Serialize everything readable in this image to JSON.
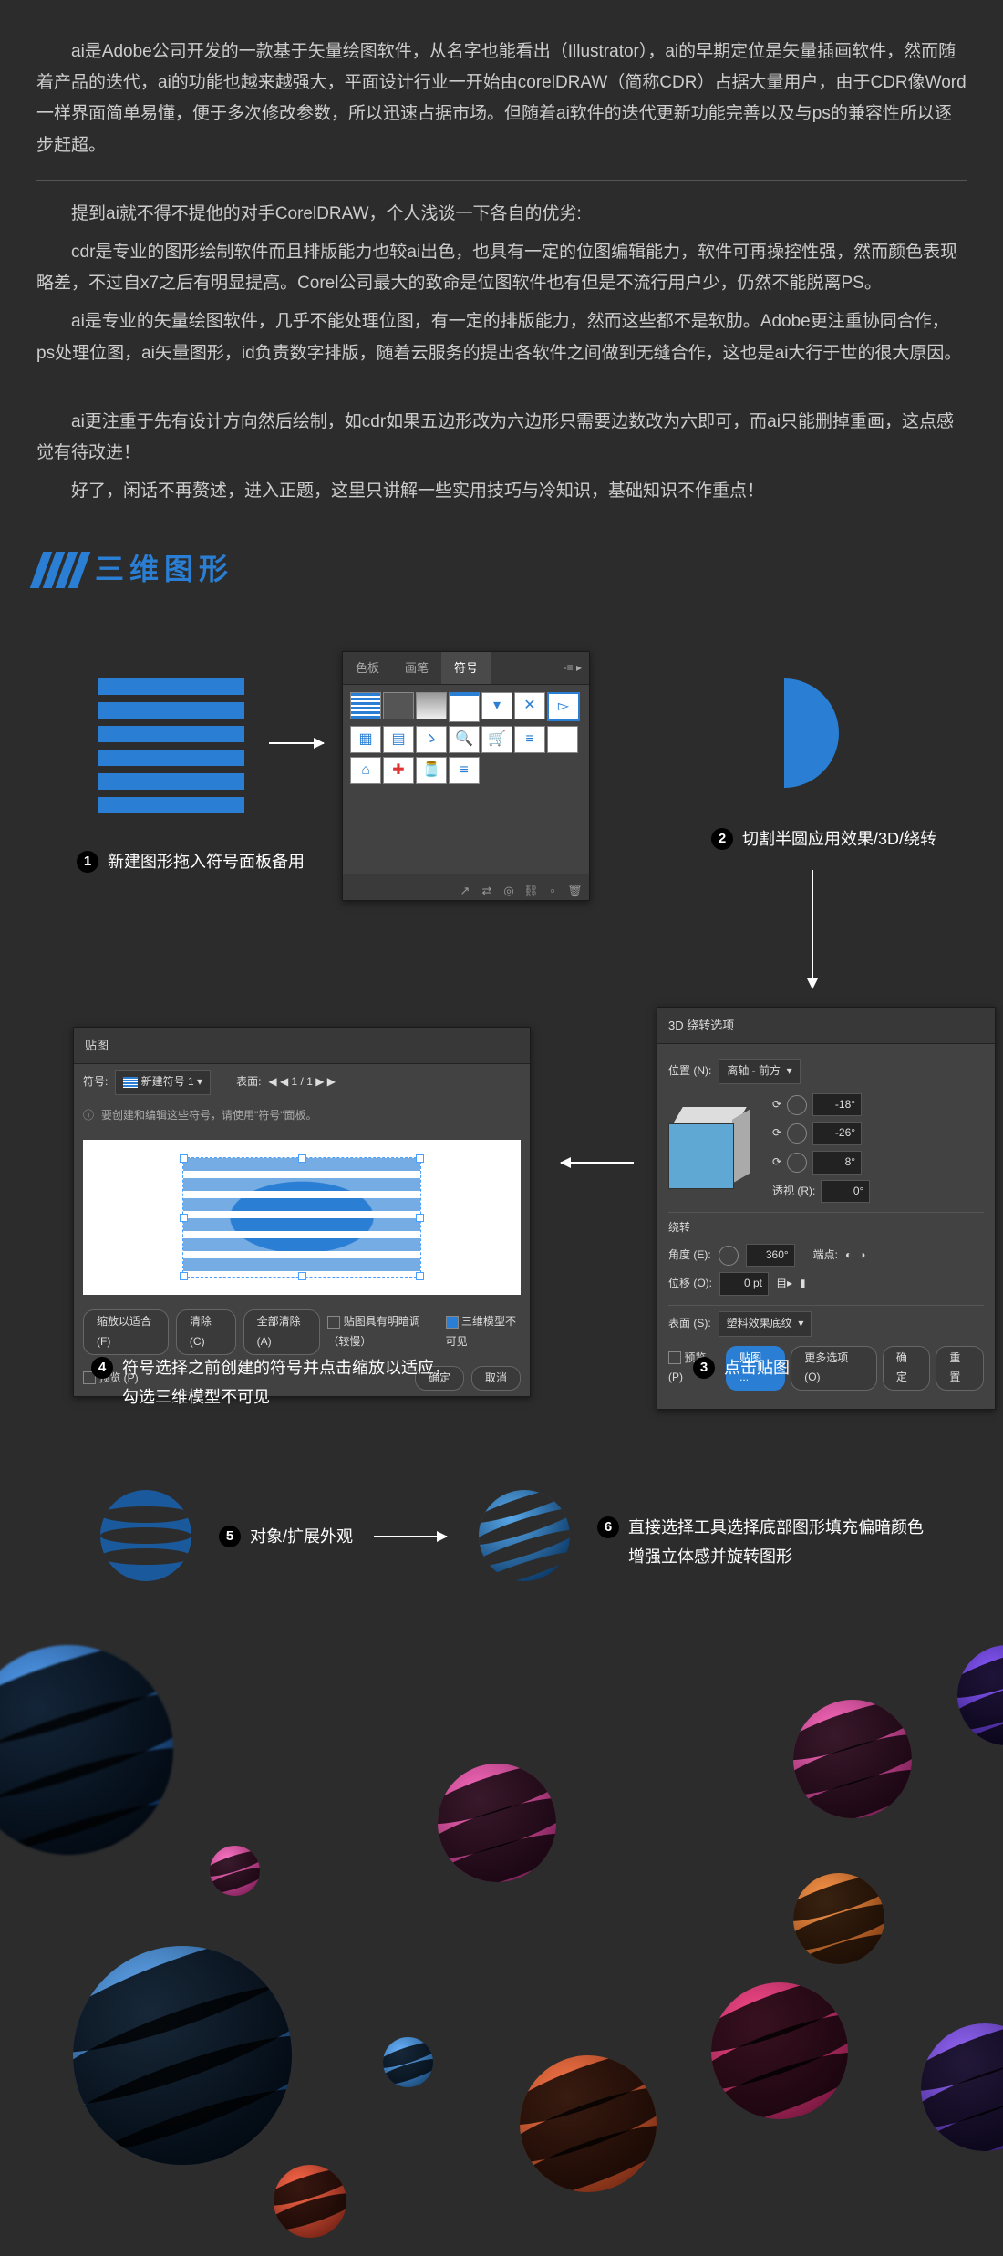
{
  "intro": {
    "p1": "ai是Adobe公司开发的一款基于矢量绘图软件，从名字也能看出（Illustrator），ai的早期定位是矢量插画软件，然而随着产品的迭代，ai的功能也越来越强大，平面设计行业一开始由corelDRAW（简称CDR）占据大量用户，由于CDR像Word一样界面简单易懂，便于多次修改参数，所以迅速占据市场。但随着ai软件的迭代更新功能完善以及与ps的兼容性所以逐步赶超。",
    "p2": "提到ai就不得不提他的对手CorelDRAW，个人浅谈一下各自的优劣:",
    "p3": "cdr是专业的图形绘制软件而且排版能力也较ai出色，也具有一定的位图编辑能力，软件可再操控性强，然而颜色表现略差，不过自x7之后有明显提高。Corel公司最大的致命是位图软件也有但是不流行用户少，仍然不能脱离PS。",
    "p4": "ai是专业的矢量绘图软件，几乎不能处理位图，有一定的排版能力，然而这些都不是软肋。Adobe更注重协同合作，ps处理位图，ai矢量图形，id负责数字排版，随着云服务的提出各软件之间做到无缝合作，这也是ai大行于世的很大原因。",
    "p5": "ai更注重于先有设计方向然后绘制，如cdr如果五边形改为六边形只需要边数改为六即可，而ai只能删掉重画，这点感觉有待改进！",
    "p6": "好了，闲话不再赘述，进入正题，这里只讲解一些实用技巧与冷知识，基础知识不作重点！"
  },
  "section_title": "三维图形",
  "steps": {
    "s1": "新建图形拖入符号面板备用",
    "s2": "切割半圆应用效果/3D/绕转",
    "s3": "点击贴图",
    "s4_l1": "符号选择之前创建的符号并点击缩放以适应，",
    "s4_l2": "勾选三维模型不可见",
    "s5": "对象/扩展外观",
    "s6_l1": "直接选择工具选择底部图形填充偏暗颜色",
    "s6_l2": "增强立体感并旋转图形"
  },
  "symbolPanel": {
    "tab1": "色板",
    "tab2": "画笔",
    "tab3": "符号",
    "menu": "-≡  ▸"
  },
  "threeD": {
    "title": "3D 绕转选项",
    "pos_label": "位置 (N):",
    "pos_value": "离轴 - 前方",
    "axis1": "-18°",
    "axis2": "-26°",
    "axis3": "8°",
    "persp_label": "透视 (R):",
    "persp_value": "0°",
    "rotate_section": "绕转",
    "angle_label": "角度 (E):",
    "angle_value": "360°",
    "cap_label": "端点:",
    "offset_label": "位移 (O):",
    "offset_value": "0 pt",
    "from_label": "自▸",
    "surface_label": "表面 (S):",
    "surface_value": "塑料效果底纹",
    "preview": "预览 (P)",
    "map_btn": "贴图 ...",
    "more_btn": "更多选项 (O)",
    "ok": "确定",
    "cancel": "重置"
  },
  "mapPanel": {
    "title": "贴图",
    "symbol_label": "符号:",
    "symbol_value": "新建符号 1",
    "surface_label": "表面:",
    "surface_nav": "◀ ◀  1 / 1  ▶ ▶",
    "tip": "要创建和编辑这些符号，请使用\"符号\"面板。",
    "fit_btn": "缩放以适合 (F)",
    "clear_btn": "清除 (C)",
    "clear_all_btn": "全部清除 (A)",
    "shade_chk": "贴图具有明暗调（较慢）",
    "invisible_chk": "三维模型不可见",
    "preview": "预览 (P)",
    "ok": "确定",
    "cancel": "取消"
  }
}
